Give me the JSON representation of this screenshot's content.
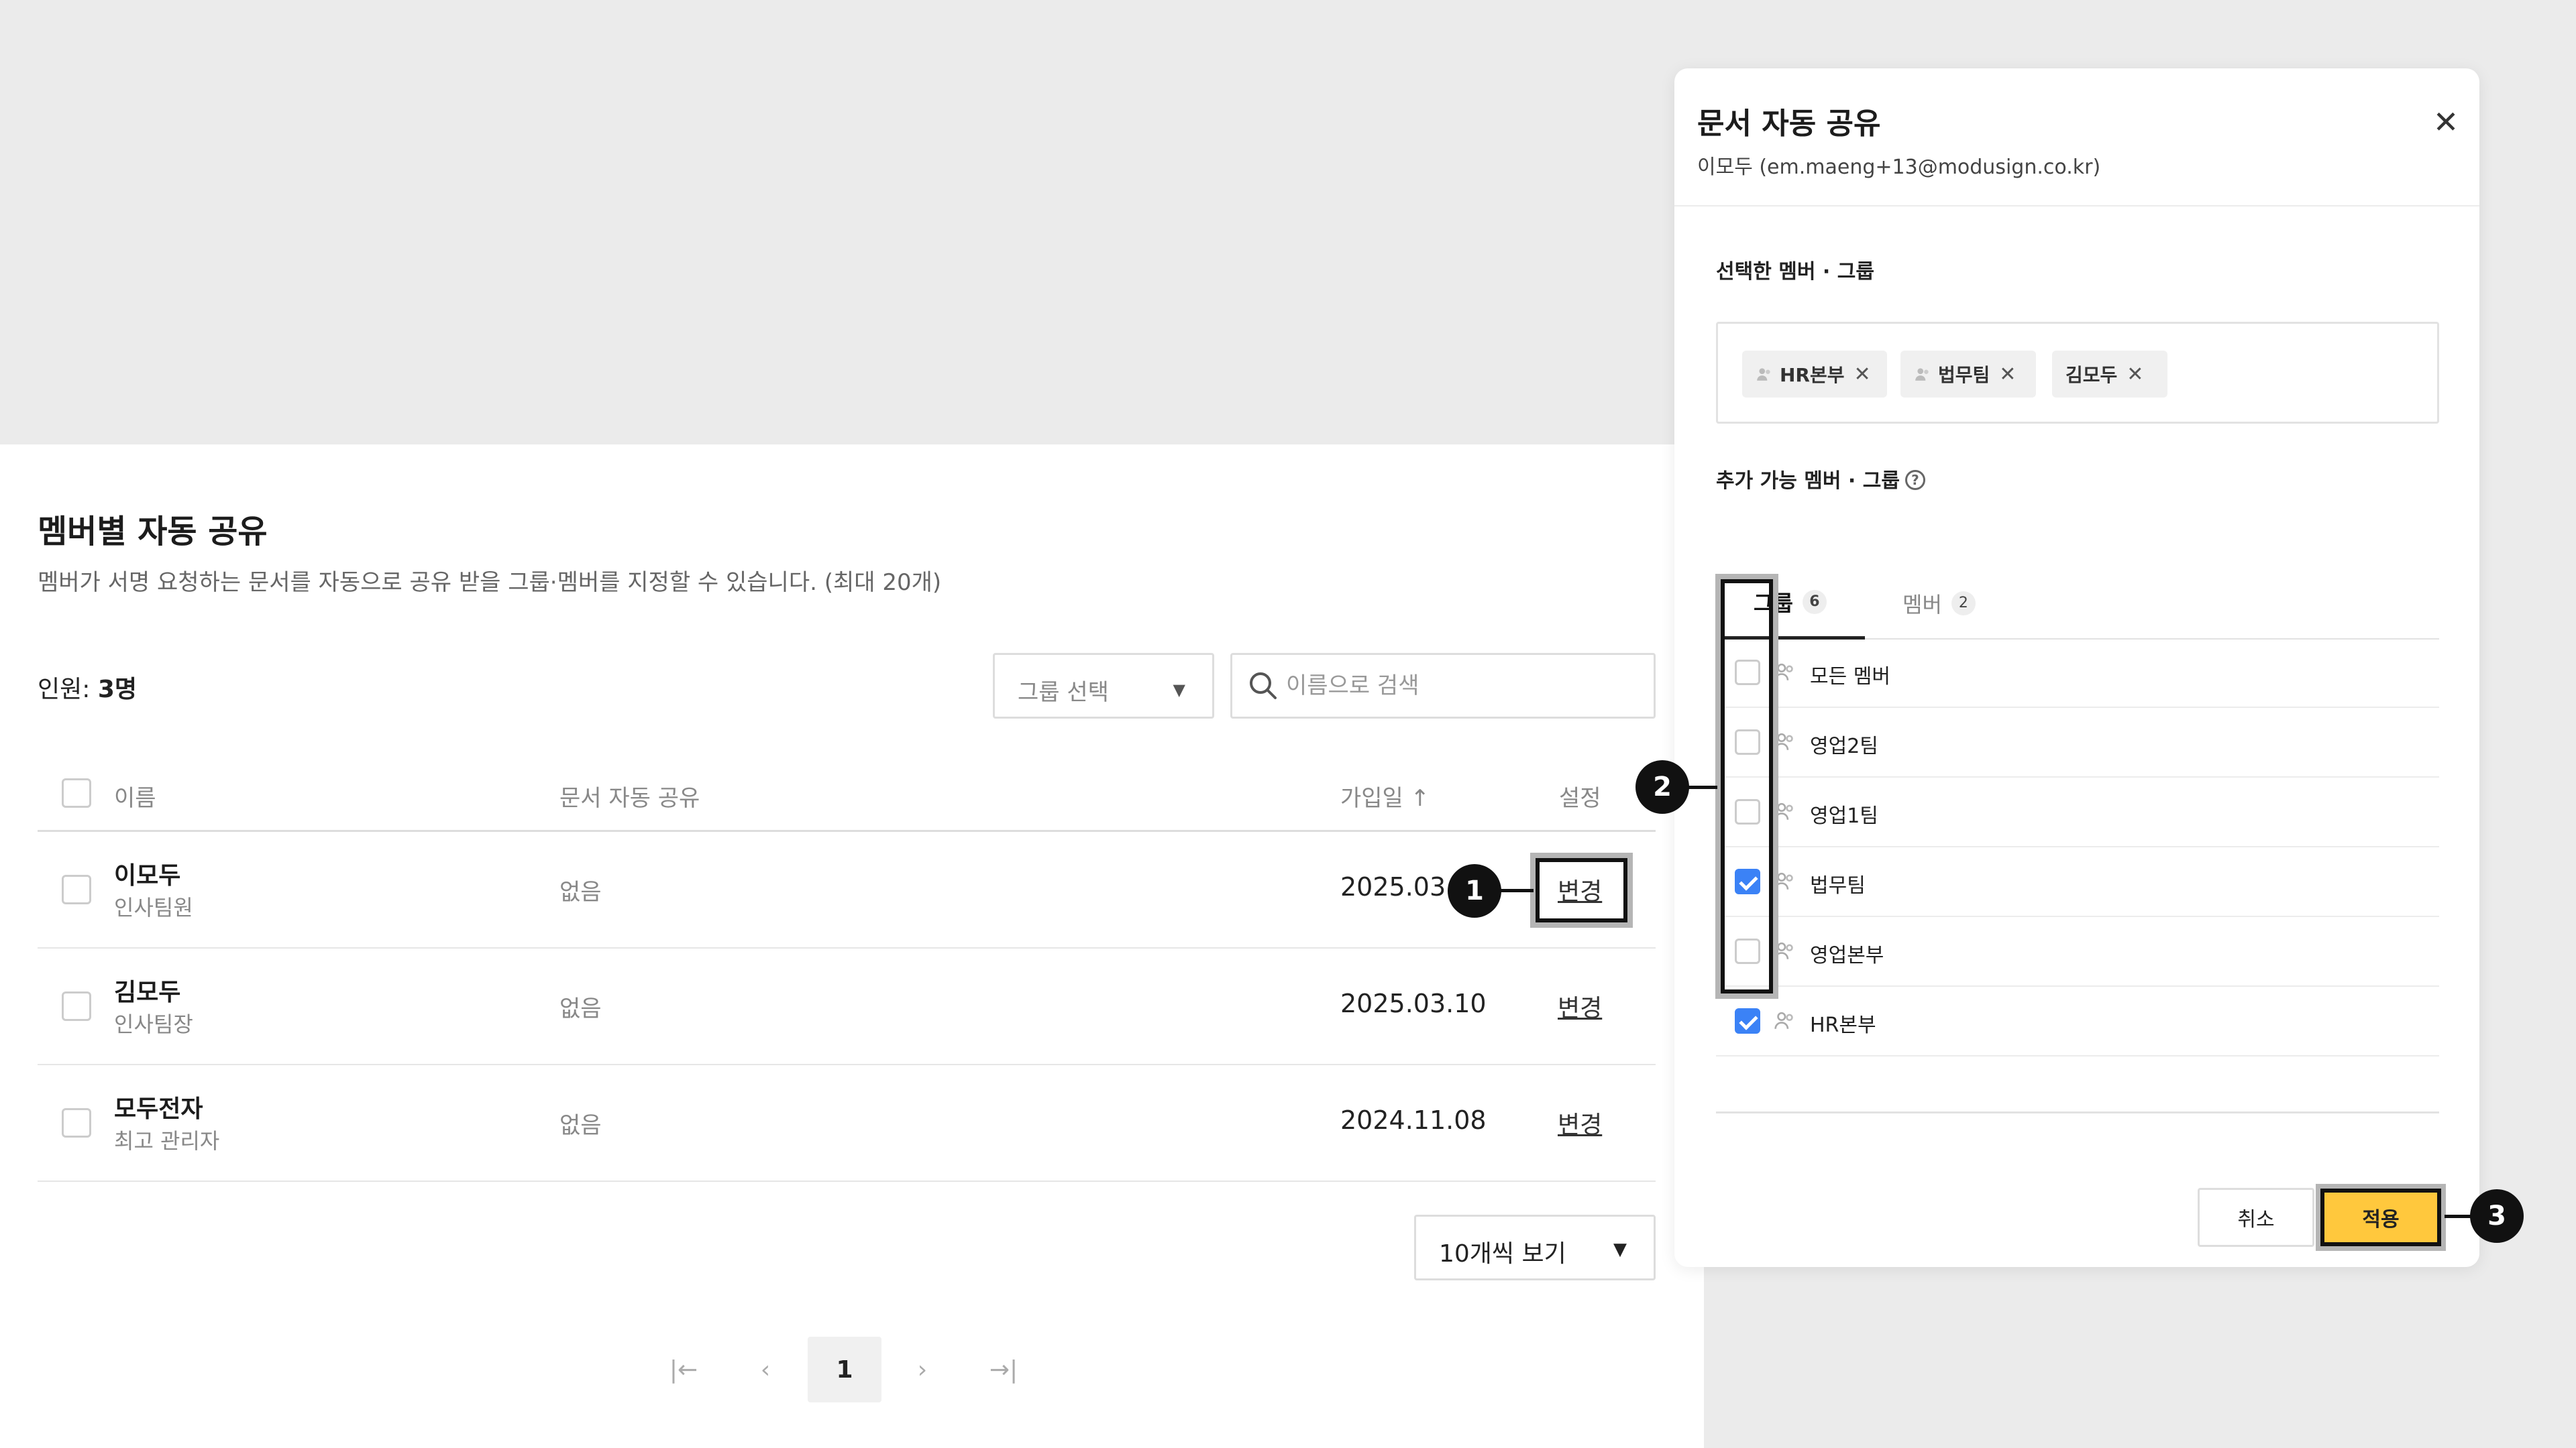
{
  "page": {
    "title": "멤버별 자동 공유",
    "description": "멤버가 서명 요청하는 문서를 자동으로 공유 받을 그룹·멤버를 지정할 수 있습니다. (최대 20개)",
    "count_label": "인원: ",
    "count_value": "3명",
    "group_select_label": "그룹 선택",
    "search_placeholder": "이름으로 검색",
    "columns": {
      "name": "이름",
      "auto_share": "문서 자동 공유",
      "joined": "가입일 ↑",
      "settings": "설정"
    },
    "rows": [
      {
        "name": "이모두",
        "role": "인사팀원",
        "share": "없음",
        "date": "2025.03.1",
        "action": "변경"
      },
      {
        "name": "김모두",
        "role": "인사팀장",
        "share": "없음",
        "date": "2025.03.10",
        "action": "변경"
      },
      {
        "name": "모두전자",
        "role": "최고 관리자",
        "share": "없음",
        "date": "2024.11.08",
        "action": "변경"
      }
    ],
    "per_page": "10개씩 보기",
    "pagination": {
      "first": "|←",
      "prev": "‹",
      "current": "1",
      "next": "›",
      "last": "→|"
    }
  },
  "modal": {
    "title": "문서 자동 공유",
    "subtitle": "이모두 (em.maeng+13@modusign.co.kr)",
    "selected_label": "선택한 멤버 · 그룹",
    "chips": [
      "HR본부",
      "법무팀",
      "김모두"
    ],
    "available_label": "추가 가능 멤버 · 그룹",
    "tabs": [
      {
        "label": "그룹",
        "count": "6"
      },
      {
        "label": "멤버",
        "count": "2"
      }
    ],
    "groups": [
      {
        "label": "모든 멤버",
        "checked": false
      },
      {
        "label": "영업2팀",
        "checked": false
      },
      {
        "label": "영업1팀",
        "checked": false
      },
      {
        "label": "법무팀",
        "checked": true
      },
      {
        "label": "영업본부",
        "checked": false
      },
      {
        "label": "HR본부",
        "checked": true
      }
    ],
    "cancel_label": "취소",
    "apply_label": "적용"
  },
  "callouts": [
    "1",
    "2",
    "3"
  ],
  "icons": {
    "close": "close-icon",
    "search": "search-icon",
    "people": "people-icon",
    "help": "help-icon",
    "dropdown": "caret-down-icon"
  },
  "colors": {
    "accent_apply": "#ffc83d",
    "checkbox_checked": "#3b82f6"
  }
}
